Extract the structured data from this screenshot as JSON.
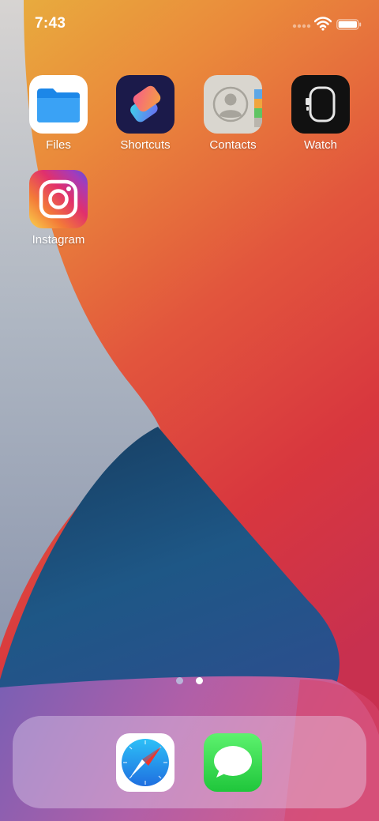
{
  "status_bar": {
    "time": "7:43",
    "wifi_icon": "wifi-icon",
    "battery_icon": "battery-icon"
  },
  "home_apps": [
    {
      "label": "Files",
      "icon": "files-icon"
    },
    {
      "label": "Shortcuts",
      "icon": "shortcuts-icon"
    },
    {
      "label": "Contacts",
      "icon": "contacts-icon"
    },
    {
      "label": "Watch",
      "icon": "watch-icon"
    },
    {
      "label": "Instagram",
      "icon": "instagram-icon"
    }
  ],
  "page_indicator": {
    "pages": 2,
    "current": 2
  },
  "dock": {
    "apps": [
      {
        "name": "Safari",
        "icon": "safari-icon"
      },
      {
        "name": "Messages",
        "icon": "messages-icon"
      }
    ]
  },
  "colors": {
    "wallpaper_orange": "#E9A23F",
    "wallpaper_red": "#D8373E",
    "wallpaper_blue": "#1E5A86",
    "wallpaper_gray": "#BFC3CC",
    "dot_active": "#FFFFFF",
    "dot_inactive": "#B8B4D8"
  }
}
